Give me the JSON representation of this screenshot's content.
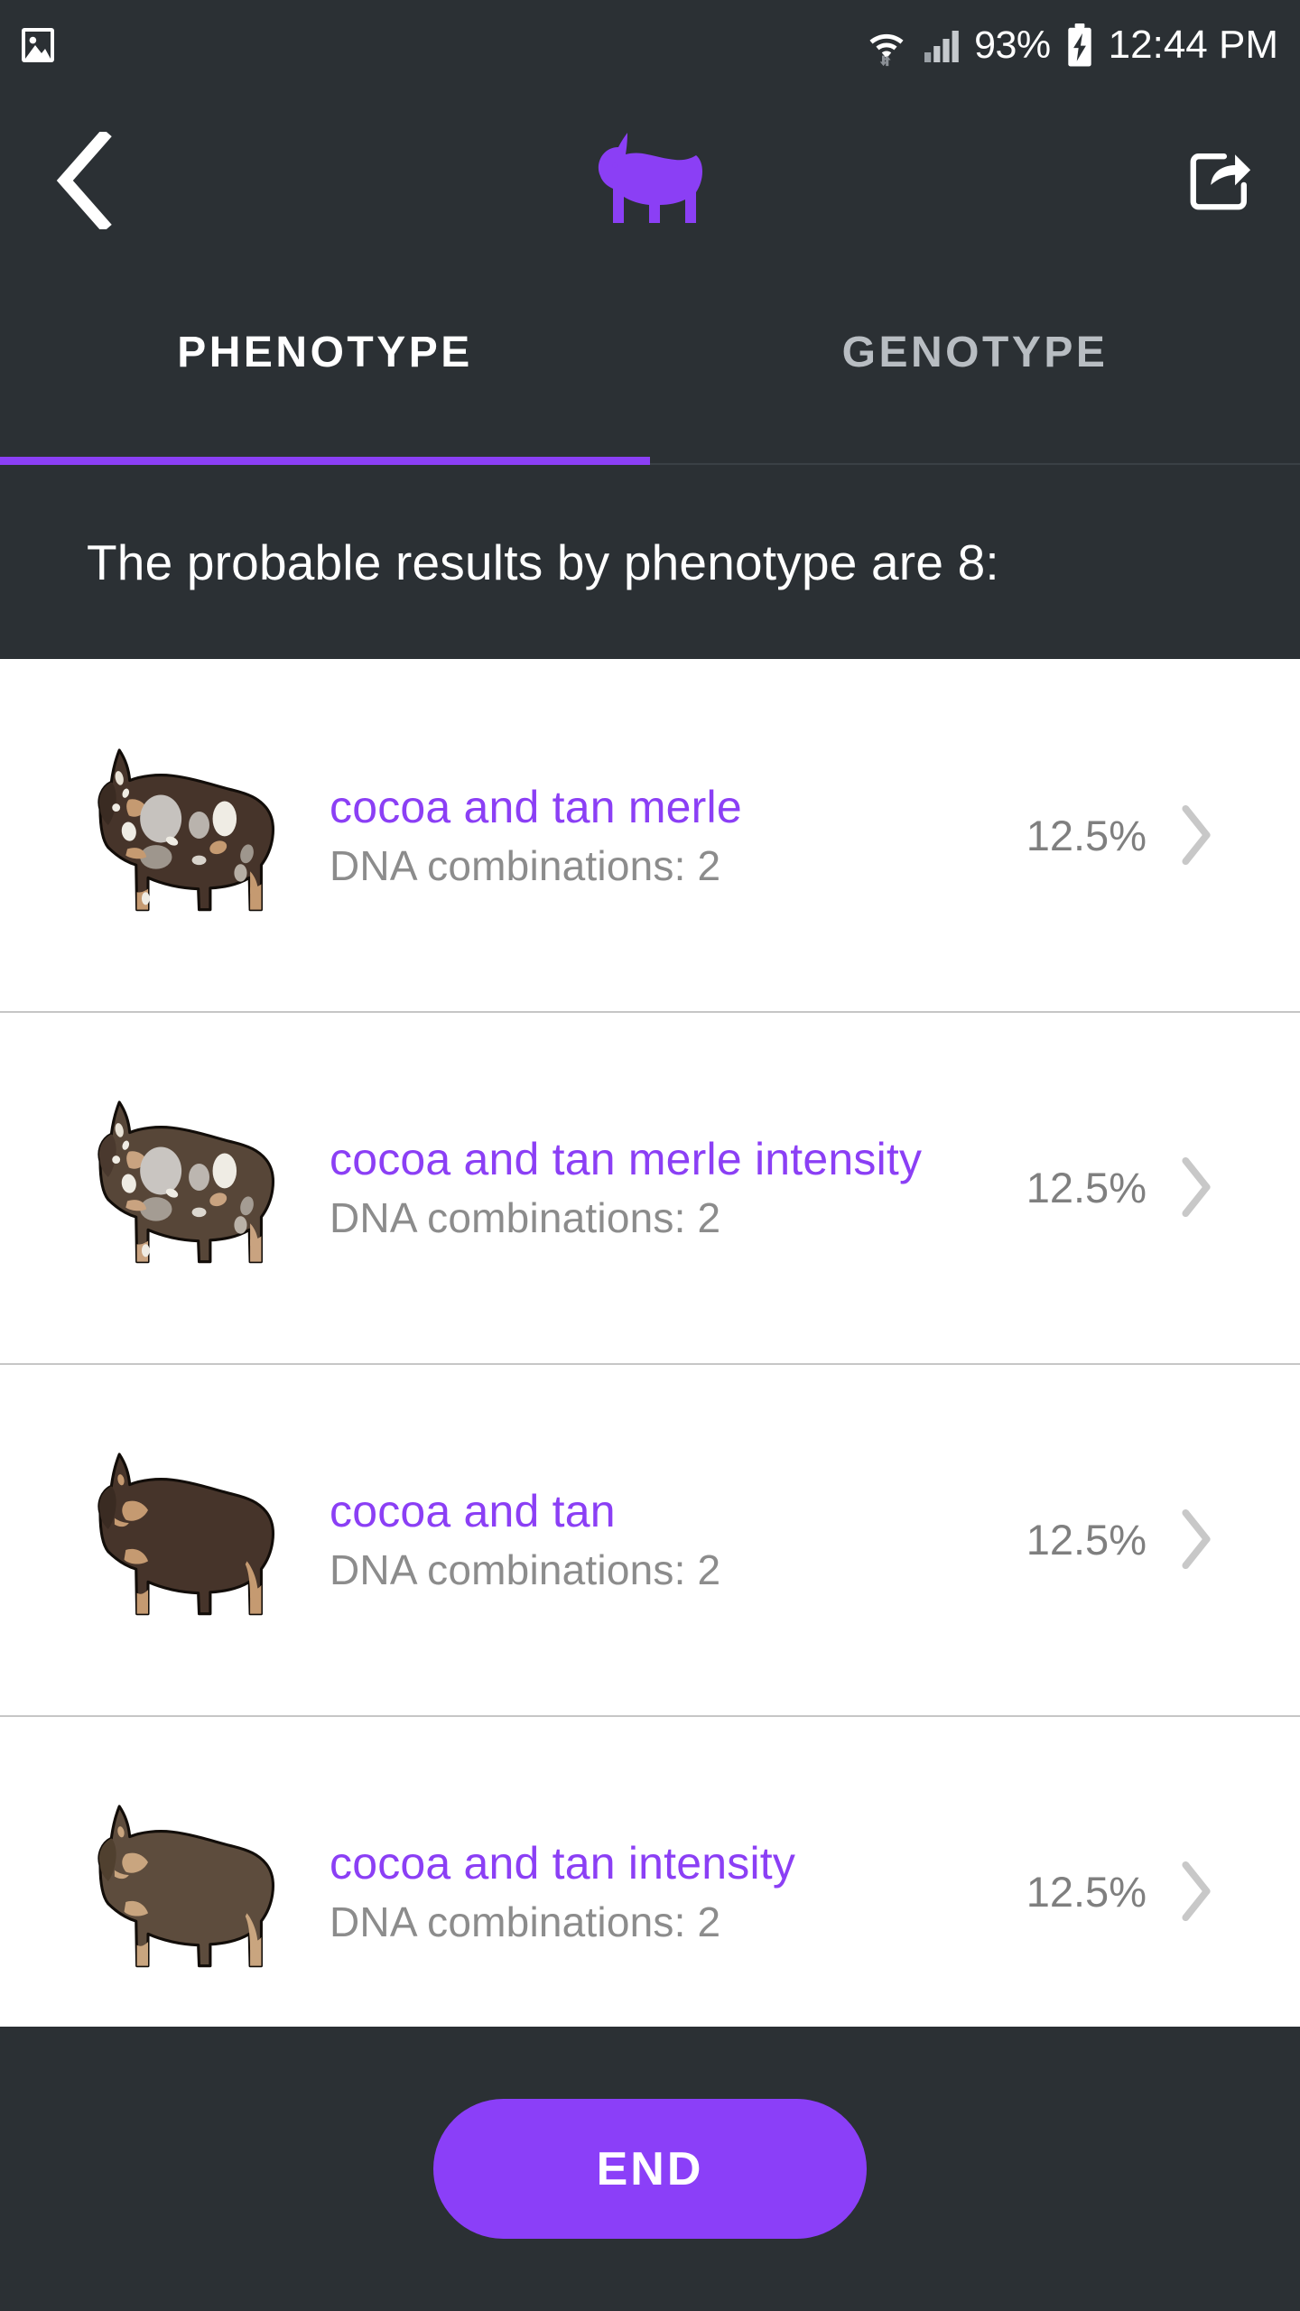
{
  "status_bar": {
    "photo_icon": "image-icon",
    "wifi_icon": "wifi-icon",
    "signal_icon": "signal-bars-icon",
    "battery_percent": "93%",
    "battery_icon": "battery-charging-icon",
    "time": "12:44 PM"
  },
  "app_bar": {
    "back_icon": "back-chevron-icon",
    "logo_icon": "dog-silhouette-icon",
    "share_icon": "share-icon",
    "accent_color": "#8b3ff5"
  },
  "tabs": {
    "items": [
      {
        "label": "PHENOTYPE",
        "active": true
      },
      {
        "label": "GENOTYPE",
        "active": false
      }
    ],
    "indicator_color": "#8b3ff5"
  },
  "heading": {
    "text": "The probable results by phenotype are 8:"
  },
  "results": {
    "count": 8,
    "rows": [
      {
        "title": "cocoa and tan merle",
        "subtitle": "DNA combinations: 2",
        "percent": "12.5%",
        "chevron_icon": "chevron-right-icon",
        "thumb_icon": "dog-cocoa-tan-merle-icon",
        "coat_base": "#46342a",
        "coat_shade": "#3a2b22",
        "patch_light": "#c6c2be",
        "patch_cream": "#efece4",
        "tan": "#c59a71"
      },
      {
        "title": "cocoa and tan merle intensity",
        "subtitle": "DNA combinations: 2",
        "percent": "12.5%",
        "chevron_icon": "chevron-right-icon",
        "thumb_icon": "dog-cocoa-tan-merle-intensity-icon",
        "coat_base": "#574638",
        "coat_shade": "#4a392e",
        "patch_light": "#c9c5c1",
        "patch_cream": "#efece4",
        "tan": "#c9a380"
      },
      {
        "title": "cocoa and tan",
        "subtitle": "DNA combinations: 2",
        "percent": "12.5%",
        "chevron_icon": "chevron-right-icon",
        "thumb_icon": "dog-cocoa-tan-icon",
        "coat_base": "#46342a",
        "coat_shade": "#3a2b22",
        "patch_light": "none",
        "patch_cream": "none",
        "tan": "#c59a71"
      },
      {
        "title": "cocoa and tan intensity",
        "subtitle": "DNA combinations: 2",
        "percent": "12.5%",
        "chevron_icon": "chevron-right-icon",
        "thumb_icon": "dog-cocoa-tan-intensity-icon",
        "coat_base": "#5d4c3d",
        "coat_shade": "#50402f",
        "patch_light": "none",
        "patch_cream": "none",
        "tan": "#c9a57f"
      }
    ]
  },
  "footer": {
    "end_label": "END",
    "button_color": "#8b3ff8"
  }
}
